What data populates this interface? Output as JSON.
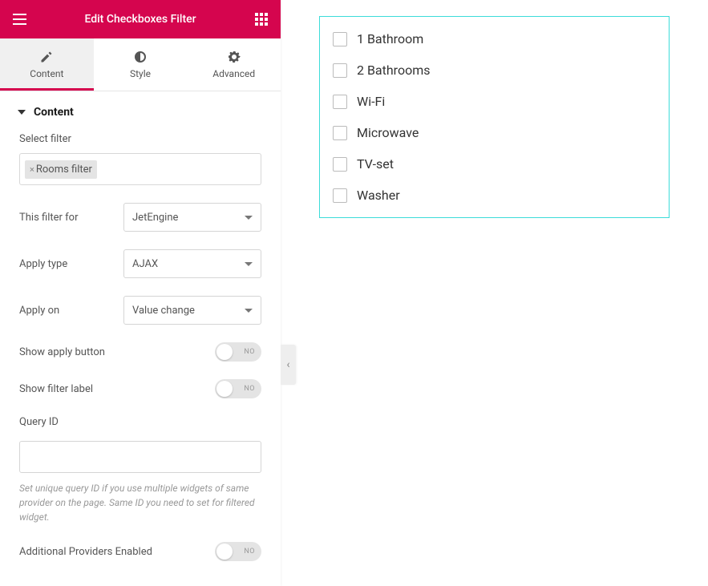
{
  "header": {
    "title": "Edit Checkboxes Filter"
  },
  "tabs": {
    "content": "Content",
    "style": "Style",
    "advanced": "Advanced"
  },
  "section": {
    "title": "Content"
  },
  "labels": {
    "select_filter": "Select filter",
    "this_filter_for": "This filter for",
    "apply_type": "Apply type",
    "apply_on": "Apply on",
    "show_apply_button": "Show apply button",
    "show_filter_label": "Show filter label",
    "query_id": "Query ID",
    "additional_providers": "Additional Providers Enabled"
  },
  "values": {
    "filter_tag": "Rooms filter",
    "this_filter_for": "JetEngine",
    "apply_type": "AJAX",
    "apply_on": "Value change",
    "toggle_no": "NO"
  },
  "help": {
    "query_id": "Set unique query ID if you use multiple widgets of same provider on the page. Same ID you need to set for filtered widget."
  },
  "preview_checkboxes": [
    "1 Bathroom",
    "2 Bathrooms",
    "Wi-Fi",
    "Microwave",
    "TV-set",
    "Washer"
  ]
}
